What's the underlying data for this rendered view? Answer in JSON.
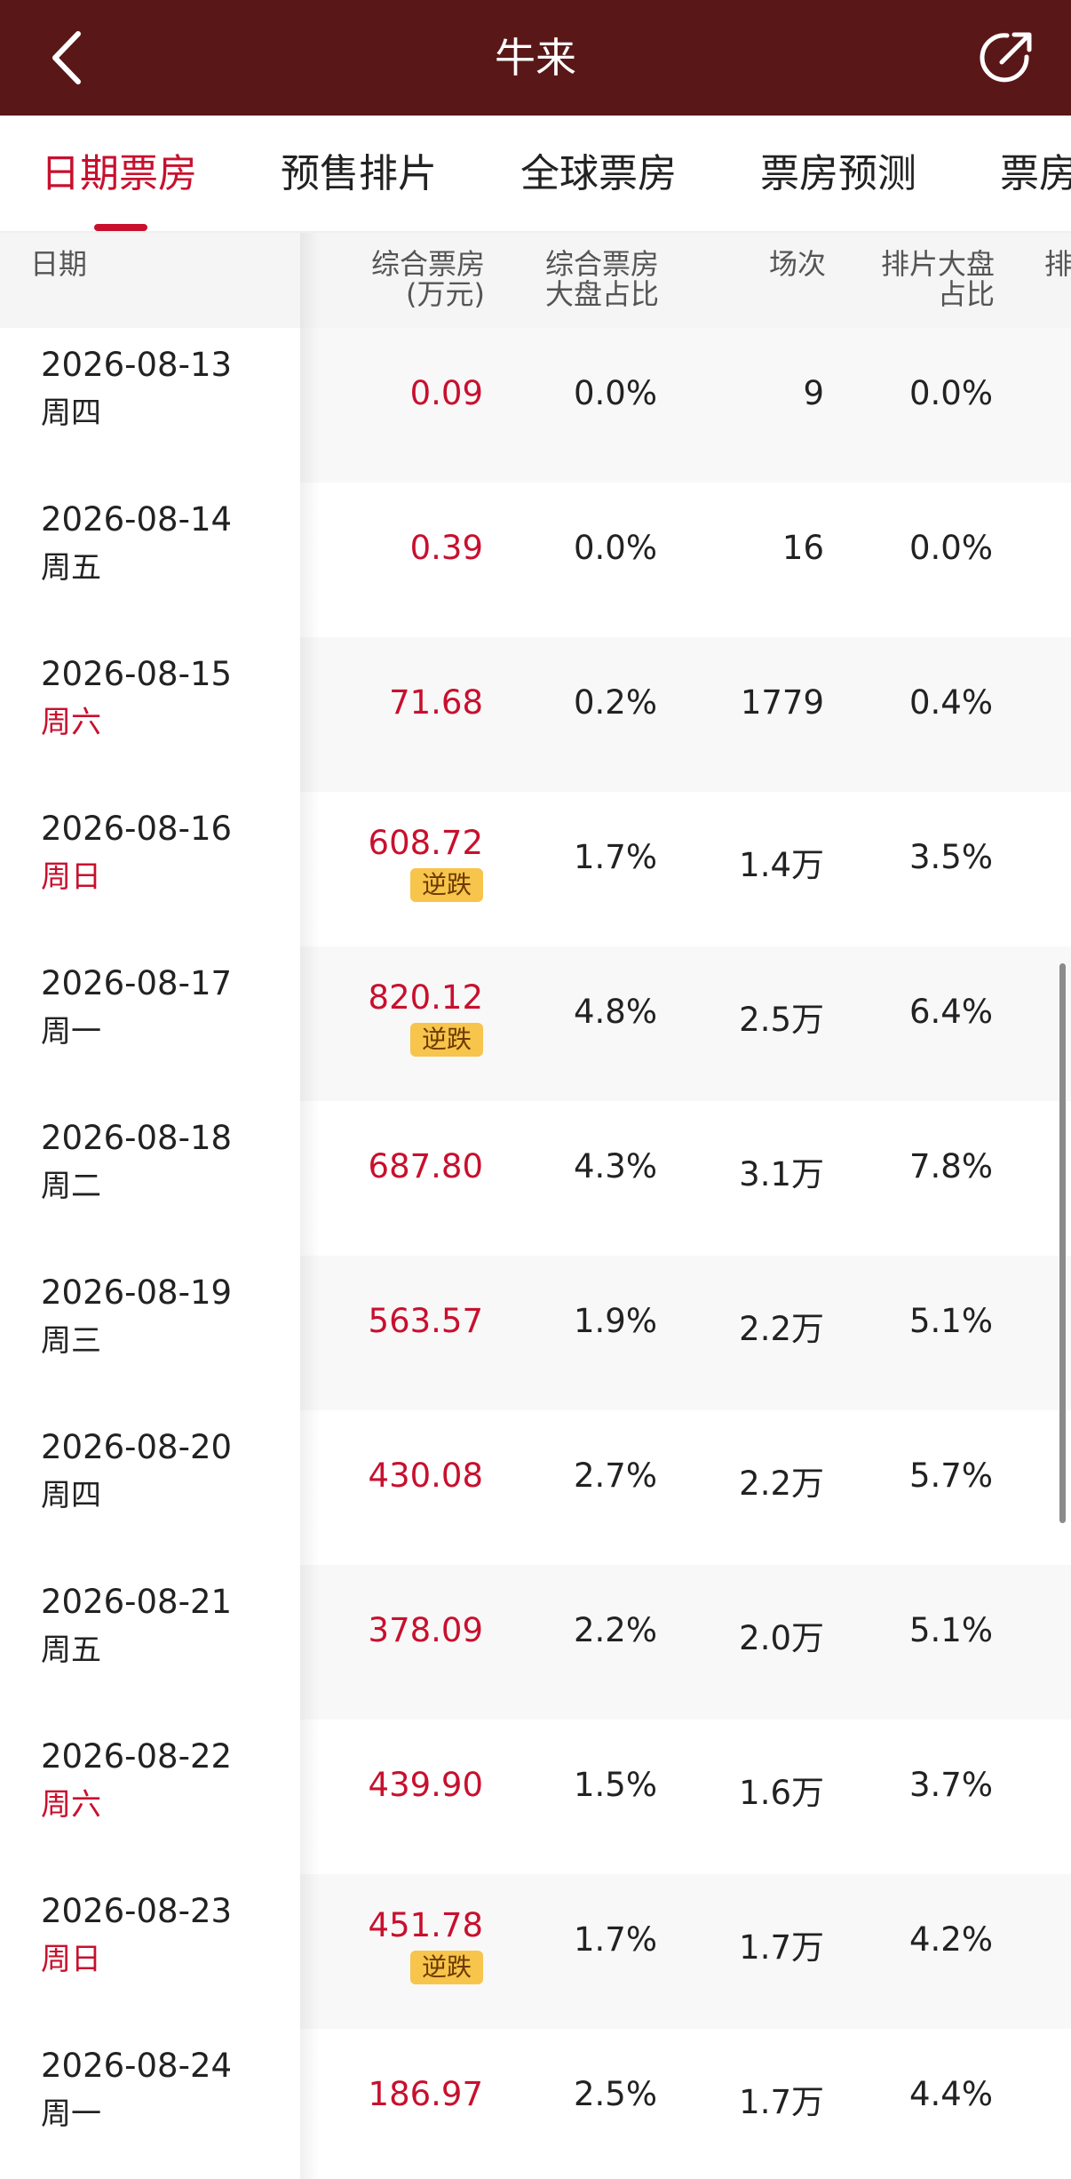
{
  "header": {
    "title": "牛来",
    "back_icon": "back-arrow-icon",
    "share_icon": "share-icon"
  },
  "tabs": [
    {
      "label": "日期票房",
      "active": true
    },
    {
      "label": "预售排片",
      "active": false
    },
    {
      "label": "全球票房",
      "active": false
    },
    {
      "label": "票房预测",
      "active": false
    },
    {
      "label": "票房",
      "active": false
    }
  ],
  "table": {
    "columns": {
      "date": "日期",
      "box_office_1": "综合票房",
      "box_office_2": "(万元)",
      "share_1": "综合票房",
      "share_2": "大盘占比",
      "screenings": "场次",
      "screen_share_1": "排片大盘",
      "screen_share_2": "占比",
      "more": "排"
    },
    "rows": [
      {
        "date": "2026-08-13",
        "weekday": "周四",
        "weekend": false,
        "box": "0.09",
        "badge": "",
        "share": "0.0%",
        "screenings": "9",
        "screen_share": "0.0%"
      },
      {
        "date": "2026-08-14",
        "weekday": "周五",
        "weekend": false,
        "box": "0.39",
        "badge": "",
        "share": "0.0%",
        "screenings": "16",
        "screen_share": "0.0%"
      },
      {
        "date": "2026-08-15",
        "weekday": "周六",
        "weekend": true,
        "box": "71.68",
        "badge": "",
        "share": "0.2%",
        "screenings": "1779",
        "screen_share": "0.4%"
      },
      {
        "date": "2026-08-16",
        "weekday": "周日",
        "weekend": true,
        "box": "608.72",
        "badge": "逆跌",
        "share": "1.7%",
        "screenings": "1.4万",
        "screen_share": "3.5%"
      },
      {
        "date": "2026-08-17",
        "weekday": "周一",
        "weekend": false,
        "box": "820.12",
        "badge": "逆跌",
        "share": "4.8%",
        "screenings": "2.5万",
        "screen_share": "6.4%"
      },
      {
        "date": "2026-08-18",
        "weekday": "周二",
        "weekend": false,
        "box": "687.80",
        "badge": "",
        "share": "4.3%",
        "screenings": "3.1万",
        "screen_share": "7.8%"
      },
      {
        "date": "2026-08-19",
        "weekday": "周三",
        "weekend": false,
        "box": "563.57",
        "badge": "",
        "share": "1.9%",
        "screenings": "2.2万",
        "screen_share": "5.1%"
      },
      {
        "date": "2026-08-20",
        "weekday": "周四",
        "weekend": false,
        "box": "430.08",
        "badge": "",
        "share": "2.7%",
        "screenings": "2.2万",
        "screen_share": "5.7%"
      },
      {
        "date": "2026-08-21",
        "weekday": "周五",
        "weekend": false,
        "box": "378.09",
        "badge": "",
        "share": "2.2%",
        "screenings": "2.0万",
        "screen_share": "5.1%"
      },
      {
        "date": "2026-08-22",
        "weekday": "周六",
        "weekend": true,
        "box": "439.90",
        "badge": "",
        "share": "1.5%",
        "screenings": "1.6万",
        "screen_share": "3.7%"
      },
      {
        "date": "2026-08-23",
        "weekday": "周日",
        "weekend": true,
        "box": "451.78",
        "badge": "逆跌",
        "share": "1.7%",
        "screenings": "1.7万",
        "screen_share": "4.2%"
      },
      {
        "date": "2026-08-24",
        "weekday": "周一",
        "weekend": false,
        "box": "186.97",
        "badge": "",
        "share": "2.5%",
        "screenings": "1.7万",
        "screen_share": "4.4%"
      }
    ]
  },
  "colors": {
    "header_bg": "#5a1717",
    "accent": "#c8102e",
    "badge_bg": "#f7c44c"
  }
}
